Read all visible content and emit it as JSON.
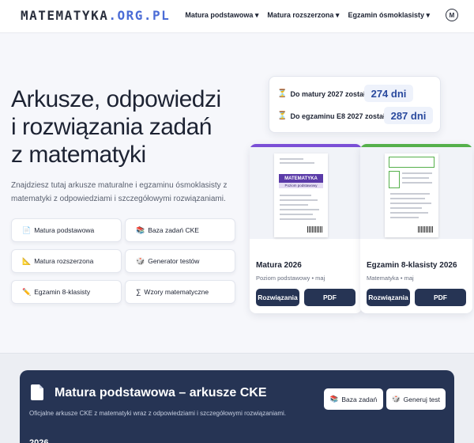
{
  "brand": {
    "name": "MATEMATYKA",
    "suffix": ".ORG.PL"
  },
  "nav": {
    "items": [
      "Matura podstawowa ▾",
      "Matura rozszerzona ▾",
      "Egzamin ósmoklasisty ▾"
    ],
    "avatar_letter": "M"
  },
  "hero": {
    "title_lines": [
      "Arkusze, odpowiedzi",
      "i rozwiązania zadań",
      "z matematyki"
    ],
    "subtitle": "Znajdziesz tutaj arkusze maturalne i egzaminu ósmoklasisty z matematyki z odpowiedziami i szczegółowymi rozwiązaniami."
  },
  "quick_links": [
    {
      "icon": "📄",
      "label": "Matura podstawowa"
    },
    {
      "icon": "📚",
      "label": "Baza zadań CKE"
    },
    {
      "icon": "📐",
      "label": "Matura rozszerzona"
    },
    {
      "icon": "🎲",
      "label": "Generator testów"
    },
    {
      "icon": "✏️",
      "label": "Egzamin 8-klasisty"
    },
    {
      "icon": "∑",
      "label": "Wzory matematyczne"
    }
  ],
  "countdown": {
    "rows": [
      {
        "label": "Do matury 2027 zostało",
        "value": "274 dni"
      },
      {
        "label": "Do egzaminu E8 2027 zostało",
        "value": "287 dni"
      }
    ],
    "icon": "hourglass-icon"
  },
  "cards": [
    {
      "title": "Matura 2026",
      "meta": "Poziom podstawowy • maj",
      "accent": "#7b4fd6",
      "thumb_header": "MATEMATYKA",
      "thumb_sub": "Poziom podstawowy",
      "solutions_label": "Rozwiązania",
      "pdf_label": "PDF"
    },
    {
      "title": "Egzamin 8-klasisty 2026",
      "meta": "Matematyka • maj",
      "accent": "#55b04b",
      "solutions_label": "Rozwiązania",
      "pdf_label": "PDF"
    }
  ],
  "section": {
    "title": "Matura podstawowa – arkusze CKE",
    "subtitle": "Oficjalne arkusze CKE z matematyki wraz z odpowiedziami i szczegółowymi rozwiązaniami.",
    "buttons": [
      {
        "icon": "📚",
        "label": "Baza zadań"
      },
      {
        "icon": "🎲",
        "label": "Generuj test"
      }
    ],
    "year": "2026"
  },
  "colors": {
    "dark": "#263454",
    "accent_blue": "#4b6cd6"
  }
}
